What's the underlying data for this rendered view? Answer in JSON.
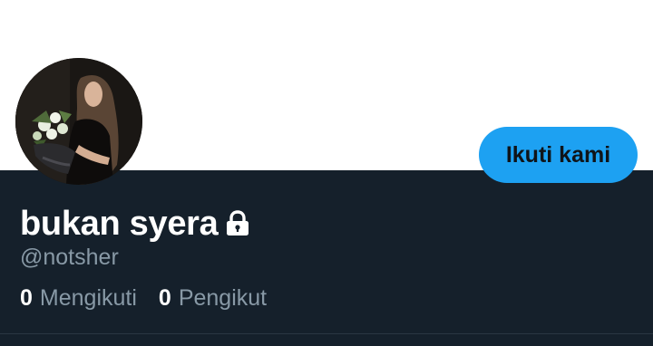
{
  "profile": {
    "display_name": "bukan syera",
    "handle": "@notsher",
    "protected_icon": "lock-icon",
    "follow_button_label": "Ikuti kami",
    "avatar": "avatar-photo"
  },
  "stats": [
    {
      "count": "0",
      "label": "Mengikuti"
    },
    {
      "count": "0",
      "label": "Pengikut"
    }
  ],
  "colors": {
    "accent": "#1da1f2",
    "panel_bg": "#15202b",
    "muted_text": "#8899a6",
    "banner_bg": "#ffffff"
  }
}
